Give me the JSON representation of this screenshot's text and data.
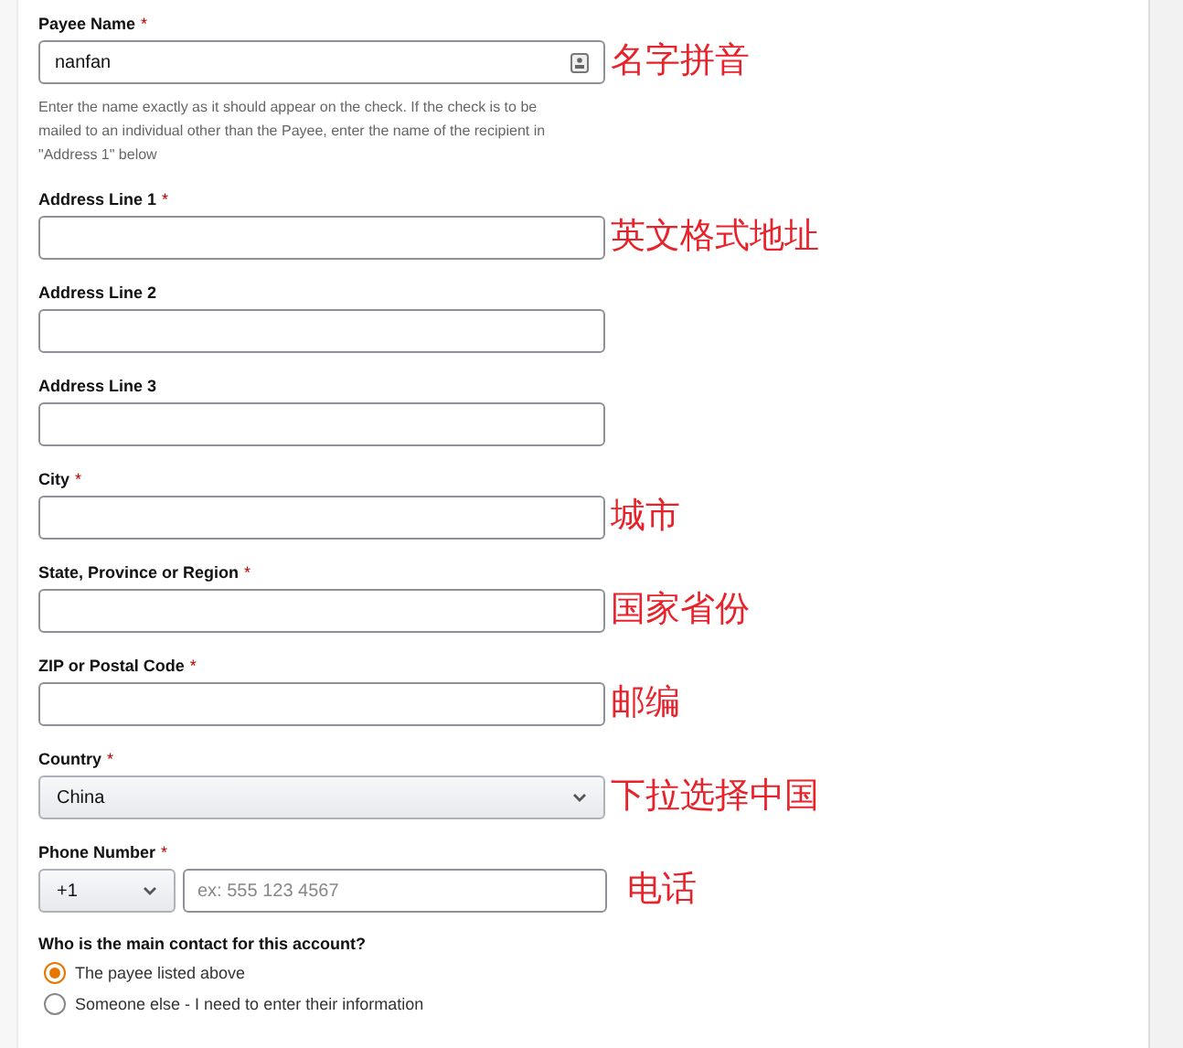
{
  "fields": [
    {
      "kind": "text",
      "label": "Payee Name",
      "required_mark": "*",
      "value": "nanfan",
      "autofill_icon": true,
      "help": "Enter the name exactly as it should appear on the check. If the check is to be mailed to an individual other than the Payee, enter the name of the recipient in \"Address 1\" below",
      "annotation": "名字拼音"
    },
    {
      "kind": "text",
      "label": "Address Line 1",
      "required_mark": "*",
      "annotation": "英文格式地址"
    },
    {
      "kind": "text",
      "label": "Address Line 2"
    },
    {
      "kind": "text",
      "label": "Address Line 3"
    },
    {
      "kind": "text",
      "label": "City",
      "required_mark": "*",
      "annotation": "城市"
    },
    {
      "kind": "text",
      "label": "State, Province or Region",
      "required_mark": "*",
      "annotation": "国家省份"
    },
    {
      "kind": "text",
      "label": "ZIP or Postal Code",
      "required_mark": "*",
      "annotation": "邮编"
    },
    {
      "kind": "select",
      "label": "Country",
      "required_mark": "*",
      "value": "China",
      "annotation": "下拉选择中国"
    },
    {
      "kind": "phone",
      "label": "Phone Number",
      "required_mark": "*",
      "code": "+1",
      "placeholder": "ex: 555 123 4567",
      "annotation": "电话"
    }
  ],
  "contact": {
    "question": "Who is the main contact for this account?",
    "options": [
      {
        "label": "The payee listed above",
        "selected": true
      },
      {
        "label": "Someone else - I need to enter their information",
        "selected": false
      }
    ]
  }
}
